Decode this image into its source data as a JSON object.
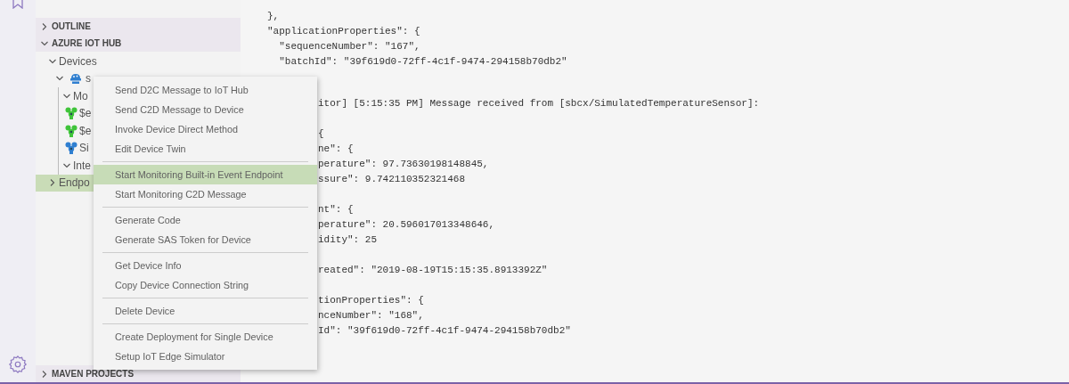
{
  "sidebar": {
    "sections": [
      {
        "title": "OUTLINE",
        "expanded": false
      },
      {
        "title": "AZURE IOT HUB",
        "expanded": true,
        "tree": [
          {
            "label": "Devices",
            "kind": "folder",
            "expanded": true,
            "selected": false,
            "children": [
              {
                "label": "s",
                "kind": "device",
                "expanded": true,
                "selected": false,
                "color": "#2f7fd0",
                "children": [
                  {
                    "label": "Mo",
                    "kind": "folder",
                    "expanded": true,
                    "selected": false,
                    "children": [
                      {
                        "label": "$e",
                        "kind": "module",
                        "selected": false,
                        "color": "#3fc43a"
                      },
                      {
                        "label": "$e",
                        "kind": "module",
                        "selected": false,
                        "color": "#3fc43a"
                      },
                      {
                        "label": "Si",
                        "kind": "module",
                        "selected": false,
                        "color": "#2f7fd0"
                      }
                    ]
                  },
                  {
                    "label": "Inte",
                    "kind": "folder",
                    "expanded": true,
                    "selected": false
                  }
                ]
              }
            ]
          },
          {
            "label": "Endpo",
            "kind": "folder",
            "expanded": false,
            "selected": true
          }
        ]
      }
    ],
    "bottom_section": {
      "title": "MAVEN PROJECTS",
      "expanded": false
    }
  },
  "editor": {
    "upper_lines": [
      "},",
      "\"applicationProperties\": {",
      "  \"sequenceNumber\": \"167\",",
      "  \"batchId\": \"39f619d0-72ff-4c1f-9474-294158b70db2\""
    ],
    "lower_groups": [
      [
        "itor] [5:15:35 PM] Message received from [sbcx/SimulatedTemperatureSensor]:"
      ],
      [
        "{",
        "ne\": {",
        "perature\": 97.73630198148845,",
        "ssure\": 9.742110352321468"
      ],
      [
        "nt\": {",
        "perature\": 20.596017013348646,",
        "idity\": 25"
      ],
      [
        "reated\": \"2019-08-19T15:15:35.8913392Z\""
      ],
      [
        "tionProperties\": {",
        "nceNumber\": \"168\",",
        "Id\": \"39f619d0-72ff-4c1f-9474-294158b70db2\""
      ]
    ]
  },
  "context_menu": {
    "groups": [
      [
        {
          "label": "Send D2C Message to IoT Hub",
          "selected": false
        },
        {
          "label": "Send C2D Message to Device",
          "selected": false
        },
        {
          "label": "Invoke Device Direct Method",
          "selected": false
        },
        {
          "label": "Edit Device Twin",
          "selected": false
        }
      ],
      [
        {
          "label": "Start Monitoring Built-in Event Endpoint",
          "selected": true
        },
        {
          "label": "Start Monitoring C2D Message",
          "selected": false
        }
      ],
      [
        {
          "label": "Generate Code",
          "selected": false
        },
        {
          "label": "Generate SAS Token for Device",
          "selected": false
        }
      ],
      [
        {
          "label": "Get Device Info",
          "selected": false
        },
        {
          "label": "Copy Device Connection String",
          "selected": false
        }
      ],
      [
        {
          "label": "Delete Device",
          "selected": false
        }
      ],
      [
        {
          "label": "Create Deployment for Single Device",
          "selected": false
        },
        {
          "label": "Setup IoT Edge Simulator",
          "selected": false
        }
      ]
    ]
  }
}
